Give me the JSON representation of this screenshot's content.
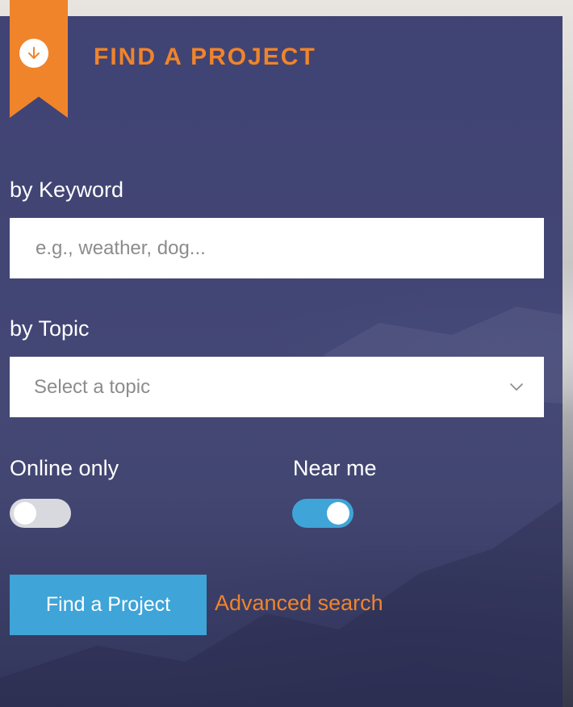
{
  "header": {
    "title": "FIND A PROJECT",
    "ribbon_icon": "arrow-down-circle-icon"
  },
  "keyword": {
    "label": "by Keyword",
    "placeholder": "e.g., weather, dog...",
    "value": ""
  },
  "topic": {
    "label": "by Topic",
    "selected": "Select a topic",
    "chevron_icon": "chevron-down-icon"
  },
  "toggles": {
    "online_only": {
      "label": "Online only",
      "on": false
    },
    "near_me": {
      "label": "Near me",
      "on": true
    }
  },
  "actions": {
    "find_button": "Find a Project",
    "advanced_link": "Advanced search"
  },
  "colors": {
    "accent_orange": "#f0842b",
    "panel_navy": "#3a3e70",
    "button_blue": "#3fa4d8",
    "toggle_off": "#d8d9de",
    "toggle_on": "#3fa4d8"
  }
}
